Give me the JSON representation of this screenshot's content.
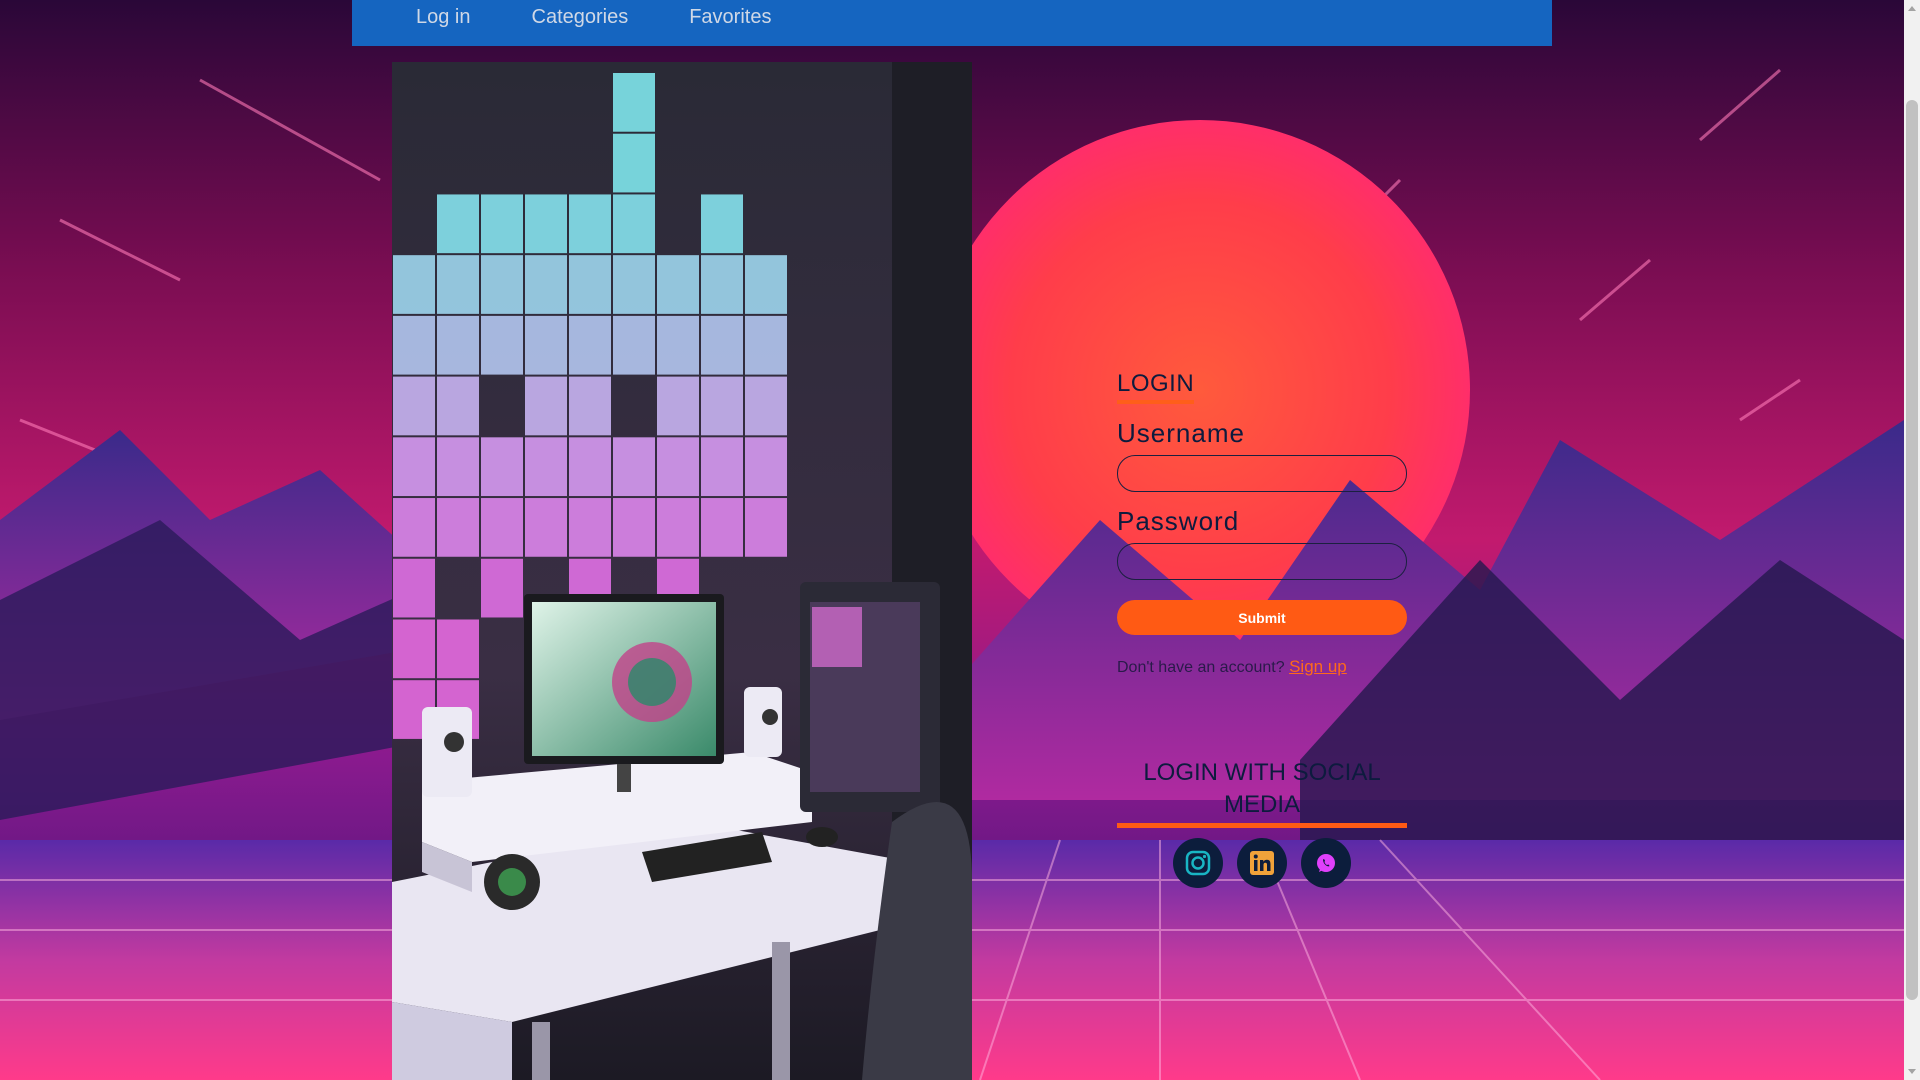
{
  "nav": {
    "items": [
      {
        "label": "Log in"
      },
      {
        "label": "Categories"
      },
      {
        "label": "Favorites"
      }
    ]
  },
  "login": {
    "title": "LOGIN",
    "username_label": "Username",
    "username_value": "",
    "password_label": "Password",
    "password_value": "",
    "submit_label": "Submit",
    "signup_prompt": "Don't have an account?",
    "signup_link": "Sign up"
  },
  "social": {
    "title": "LOGIN WITH SOCIAL MEDIA",
    "icons": [
      "instagram-icon",
      "linkedin-icon",
      "whatsapp-icon"
    ]
  },
  "colors": {
    "nav_bg": "#1565c0",
    "accent": "#ff5a14",
    "social_bg": "#0c1d3c",
    "instagram": "#19b5c4",
    "linkedin": "#f0a23a",
    "whatsapp": "#e040fb"
  }
}
